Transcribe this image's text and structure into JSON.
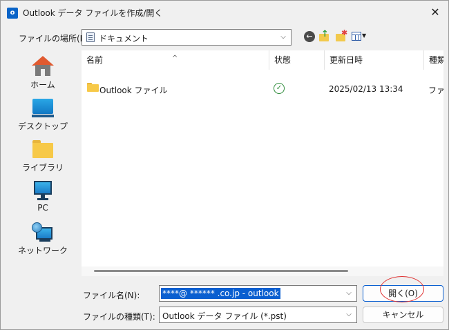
{
  "window": {
    "title": "Outlook データ ファイルを作成/開く",
    "app_icon_letter": "o",
    "close_glyph": "✕"
  },
  "location": {
    "label": "ファイルの場所(I):",
    "value": "ドキュメント",
    "dropdown_glyph": "⌵"
  },
  "places": [
    {
      "label": "ホーム",
      "icon": "home-icon"
    },
    {
      "label": "デスクトップ",
      "icon": "desktop-icon"
    },
    {
      "label": "ライブラリ",
      "icon": "library-folder-icon"
    },
    {
      "label": "PC",
      "icon": "pc-icon"
    },
    {
      "label": "ネットワーク",
      "icon": "network-icon"
    }
  ],
  "columns": [
    {
      "label": "名前"
    },
    {
      "label": "状態"
    },
    {
      "label": "更新日時"
    },
    {
      "label": "種類"
    }
  ],
  "sort_caret": "^",
  "files": [
    {
      "name": "Outlook ファイル",
      "status": "ok",
      "modified": "2025/02/13 13:34",
      "type": "ファイ"
    }
  ],
  "filename": {
    "label": "ファイル名(N):",
    "value": "****@ ****** .co.jp - outlook"
  },
  "filetype": {
    "label": "ファイルの種類(T):",
    "value": "Outlook データ ファイル (*.pst)"
  },
  "buttons": {
    "open": "開く(O)",
    "cancel": "キャンセル"
  },
  "colors": {
    "selection": "#0a5fd0",
    "annotation": "#e03030"
  }
}
